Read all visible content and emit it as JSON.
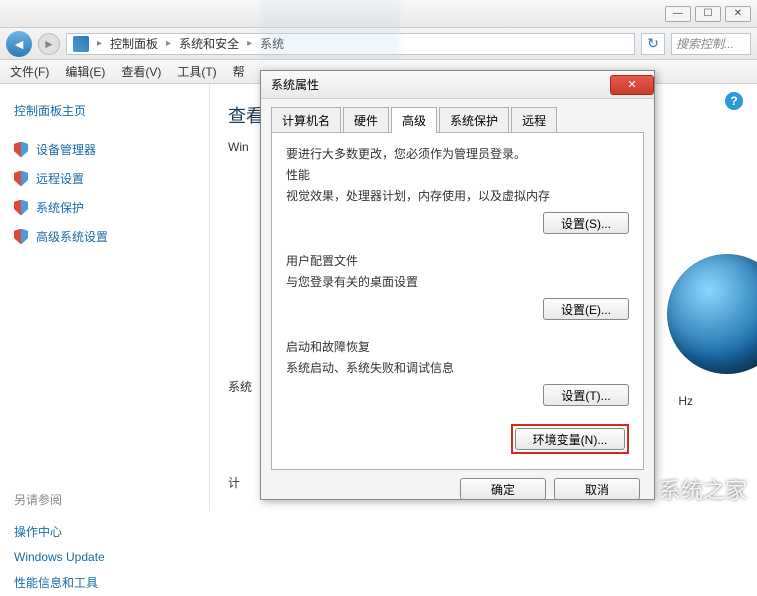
{
  "titlebar": {
    "min": "—",
    "max": "☐",
    "close": "✕"
  },
  "nav": {
    "segments": [
      "控制面板",
      "系统和安全",
      "系统"
    ],
    "search_placeholder": "搜索控制..."
  },
  "menubar": [
    "文件(F)",
    "编辑(E)",
    "查看(V)",
    "工具(T)",
    "帮"
  ],
  "sidebar": {
    "title": "控制面板主页",
    "items": [
      "设备管理器",
      "远程设置",
      "系统保护",
      "高级系统设置"
    ],
    "see_also_title": "另请参阅",
    "see_also": [
      "操作中心",
      "Windows Update",
      "性能信息和工具"
    ]
  },
  "content": {
    "heading": "查看",
    "line1": "Win",
    "line_bottom1": "系统",
    "line_bottom2": "计",
    "hz": "Hz"
  },
  "dialog": {
    "title": "系统属性",
    "tabs": [
      "计算机名",
      "硬件",
      "高级",
      "系统保护",
      "远程"
    ],
    "active_tab": 2,
    "admin_note": "要进行大多数更改，您必须作为管理员登录。",
    "sections": [
      {
        "label": "性能",
        "desc": "视觉效果，处理器计划，内存使用，以及虚拟内存",
        "btn": "设置(S)..."
      },
      {
        "label": "用户配置文件",
        "desc": "与您登录有关的桌面设置",
        "btn": "设置(E)..."
      },
      {
        "label": "启动和故障恢复",
        "desc": "系统启动、系统失败和调试信息",
        "btn": "设置(T)..."
      }
    ],
    "env_btn": "环境变量(N)...",
    "ok": "确定",
    "cancel": "取消"
  },
  "watermark": "系统之家"
}
